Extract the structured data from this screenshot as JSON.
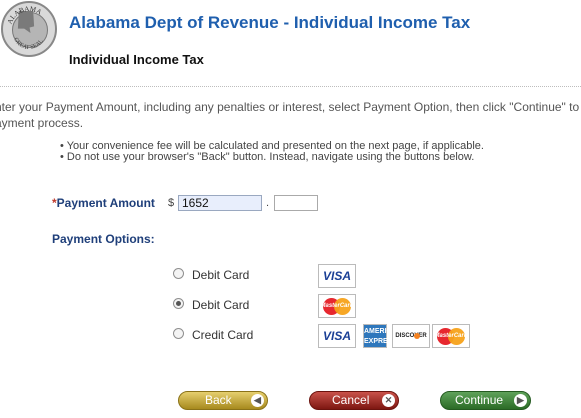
{
  "header": {
    "seal_text_top": "ALABAMA",
    "seal_text_bottom": "GREAT SEAL",
    "title": "Alabama Dept of Revenue - Individual Income Tax",
    "subtitle": "Individual Income Tax"
  },
  "instructions": {
    "line1": "nter your Payment Amount, including any penalties or interest, select Payment Option, then click \"Continue\" to",
    "line2": "ayment process.",
    "bullets": [
      "• Your convenience fee will be calculated and presented on the next page, if applicable.",
      "• Do not use your browser's \"Back\" button. Instead, navigate using the buttons below."
    ]
  },
  "payment": {
    "required_mark": "*",
    "amount_label": "Payment Amount",
    "currency_symbol": "$",
    "amount_value": "1652",
    "decimal_sep": ".",
    "cents_value": ""
  },
  "options": {
    "label": "Payment Options:",
    "items": [
      {
        "label": "Debit Card",
        "selected": false,
        "cards": [
          "VISA"
        ]
      },
      {
        "label": "Debit Card",
        "selected": true,
        "cards": [
          "MasterCard"
        ]
      },
      {
        "label": "Credit Card",
        "selected": false,
        "cards": [
          "VISA",
          "AMERICAN EXPRESS",
          "DISCOVER",
          "MasterCard"
        ]
      }
    ]
  },
  "buttons": {
    "back": "Back",
    "cancel": "Cancel",
    "continue": "Continue"
  },
  "colors": {
    "title": "#1f5fae",
    "label": "#1f3f7a",
    "back_button": "#c2a73a",
    "cancel_button": "#a1312a",
    "continue_button": "#3f833a"
  }
}
